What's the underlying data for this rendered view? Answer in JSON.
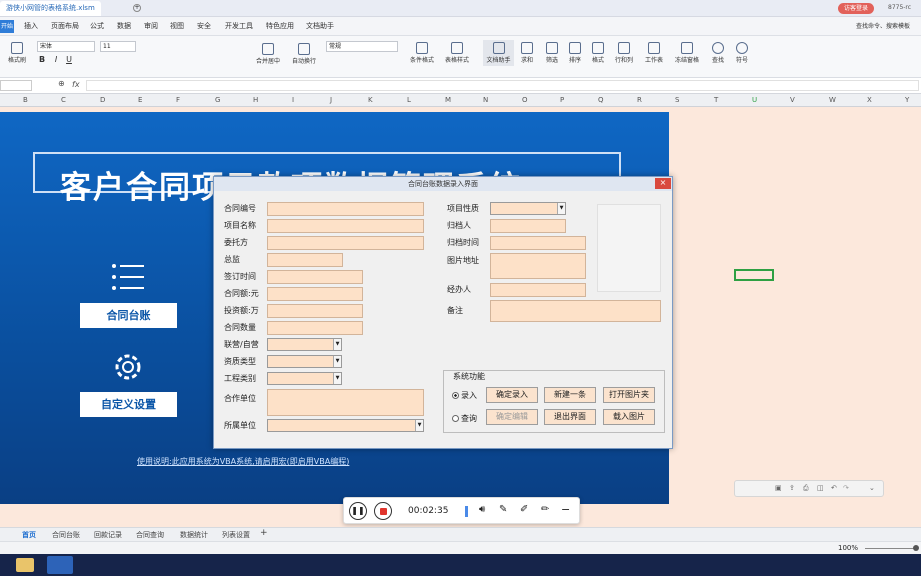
{
  "app": {
    "doc_tab": "游侠小网管的表格系统.xlsm",
    "login": "访客登录",
    "title_right": "8775-rc"
  },
  "menu": {
    "start": "开始",
    "items": [
      "插入",
      "页面布局",
      "公式",
      "数据",
      "审阅",
      "视图",
      "安全",
      "开发工具",
      "特色应用",
      "文档助手"
    ],
    "search": "查找命令、搜索模板"
  },
  "ribbon": {
    "format_painter": "格式刷",
    "font": "宋体",
    "size": "11",
    "number_format": "常规",
    "merge": "合并居中",
    "wrap": "自动换行",
    "cond_format": "条件格式",
    "table_style": "表格样式",
    "doc_helper": "文档助手",
    "sum": "求和",
    "filter": "筛选",
    "sort": "排序",
    "format": "格式",
    "rowcol": "行和列",
    "sheet": "工作表",
    "freeze": "冻结窗格",
    "find": "查找",
    "symbol": "符号"
  },
  "formula_bar": {
    "fx": "fx"
  },
  "columns": [
    "B",
    "C",
    "D",
    "E",
    "F",
    "G",
    "H",
    "I",
    "J",
    "K",
    "L",
    "M",
    "N",
    "O",
    "P",
    "Q",
    "R",
    "S",
    "T",
    "U",
    "V",
    "W",
    "X",
    "Y"
  ],
  "sheet": {
    "title": "客户合同项目款项数据管理系统",
    "contract_ledger": "合同台账",
    "custom_settings": "自定义设置",
    "usage": "使用说明:此应用系统为VBA系统,请启用宏(即启用VBA编程)"
  },
  "dialog": {
    "title": "合同台账数据录入界面",
    "close": "×",
    "left_labels": [
      "合同编号",
      "项目名称",
      "委托方",
      "总监",
      "签订时间",
      "合同额:元",
      "投资额:万",
      "合同数量",
      "联营/自营",
      "资质类型",
      "工程类别",
      "合作单位",
      "所属单位"
    ],
    "right_labels": [
      "项目性质",
      "归档人",
      "归档时间",
      "图片地址",
      "经办人",
      "备注"
    ],
    "group_title": "系统功能",
    "radio_entry": "录入",
    "radio_query": "查询",
    "buttons": {
      "confirm_entry": "确定录入",
      "new_entry": "新建一条",
      "open_images": "打开图片夹",
      "confirm_edit": "确定编辑",
      "exit": "退出界面",
      "load_image": "载入图片"
    }
  },
  "recorder": {
    "time": "00:02:35"
  },
  "tabs": [
    "首页",
    "合同台账",
    "回款记录",
    "合同查询",
    "数据统计",
    "列表设置"
  ],
  "status": {
    "zoom": "100%"
  }
}
